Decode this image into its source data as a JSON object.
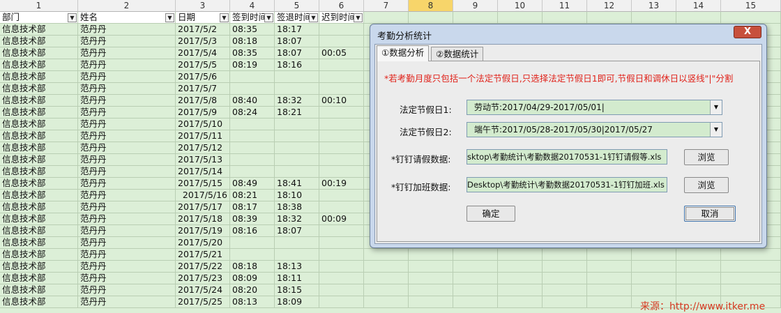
{
  "columns": [
    "1",
    "2",
    "3",
    "4",
    "5",
    "6",
    "7",
    "8",
    "9",
    "10",
    "11",
    "12",
    "13",
    "14",
    "15"
  ],
  "selected_column": "8",
  "headers": [
    "部门",
    "姓名",
    "日期",
    "签到时间",
    "签退时间",
    "迟到时间"
  ],
  "rows": [
    [
      "信息技术部",
      "范丹丹",
      "2017/5/2",
      "08:35",
      "18:17",
      ""
    ],
    [
      "信息技术部",
      "范丹丹",
      "2017/5/3",
      "08:18",
      "18:07",
      ""
    ],
    [
      "信息技术部",
      "范丹丹",
      "2017/5/4",
      "08:35",
      "18:07",
      "00:05"
    ],
    [
      "信息技术部",
      "范丹丹",
      "2017/5/5",
      "08:19",
      "18:16",
      ""
    ],
    [
      "信息技术部",
      "范丹丹",
      "2017/5/6",
      "",
      "",
      ""
    ],
    [
      "信息技术部",
      "范丹丹",
      "2017/5/7",
      "",
      "",
      ""
    ],
    [
      "信息技术部",
      "范丹丹",
      "2017/5/8",
      "08:40",
      "18:32",
      "00:10"
    ],
    [
      "信息技术部",
      "范丹丹",
      "2017/5/9",
      "08:24",
      "18:21",
      ""
    ],
    [
      "信息技术部",
      "范丹丹",
      "2017/5/10",
      "",
      "",
      ""
    ],
    [
      "信息技术部",
      "范丹丹",
      "2017/5/11",
      "",
      "",
      ""
    ],
    [
      "信息技术部",
      "范丹丹",
      "2017/5/12",
      "",
      "",
      ""
    ],
    [
      "信息技术部",
      "范丹丹",
      "2017/5/13",
      "",
      "",
      ""
    ],
    [
      "信息技术部",
      "范丹丹",
      "2017/5/14",
      "",
      "",
      ""
    ],
    [
      "信息技术部",
      "范丹丹",
      "2017/5/15",
      "08:49",
      "18:41",
      "00:19"
    ],
    [
      "信息技术部",
      "范丹丹",
      "2017/5/16",
      "08:21",
      "18:10",
      ""
    ],
    [
      "信息技术部",
      "范丹丹",
      "2017/5/17",
      "08:17",
      "18:38",
      ""
    ],
    [
      "信息技术部",
      "范丹丹",
      "2017/5/18",
      "08:39",
      "18:32",
      "00:09"
    ],
    [
      "信息技术部",
      "范丹丹",
      "2017/5/19",
      "08:16",
      "18:07",
      ""
    ],
    [
      "信息技术部",
      "范丹丹",
      "2017/5/20",
      "",
      "",
      ""
    ],
    [
      "信息技术部",
      "范丹丹",
      "2017/5/21",
      "",
      "",
      ""
    ],
    [
      "信息技术部",
      "范丹丹",
      "2017/5/22",
      "08:18",
      "18:13",
      ""
    ],
    [
      "信息技术部",
      "范丹丹",
      "2017/5/23",
      "08:09",
      "18:11",
      ""
    ],
    [
      "信息技术部",
      "范丹丹",
      "2017/5/24",
      "08:20",
      "18:15",
      ""
    ],
    [
      "信息技术部",
      "范丹丹",
      "2017/5/25",
      "08:13",
      "18:09",
      ""
    ]
  ],
  "right_aligned_row": 14,
  "dialog": {
    "title": "考勤分析统计",
    "close": "X",
    "tabs": [
      "①数据分析",
      "②数据统计"
    ],
    "notice": "*若考勤月度只包括一个法定节假日,只选择法定节假日1即可,节假日和调休日以竖线\"|\"分割",
    "holiday1_label": "法定节假日1:",
    "holiday1_value": "劳动节:2017/04/29-2017/05/01|",
    "holiday2_label": "法定节假日2:",
    "holiday2_value": "端午节:2017/05/28-2017/05/30|2017/05/27",
    "leave_label": "*钉钉请假数据:",
    "leave_value": "sktop\\考勤统计\\考勤数据20170531-1钉钉请假等.xls",
    "overtime_label": "*钉钉加班数据:",
    "overtime_value": "Desktop\\考勤统计\\考勤数据20170531-1钉钉加班.xls",
    "browse": "浏览",
    "ok": "确定",
    "cancel": "取消"
  },
  "watermark": "来源：http://www.itker.me",
  "colors": {
    "cell_bg": "#dcefd7",
    "header_bg": "#f1f1f1",
    "selected_header": "#f7d56a",
    "notice": "#e0231b"
  }
}
